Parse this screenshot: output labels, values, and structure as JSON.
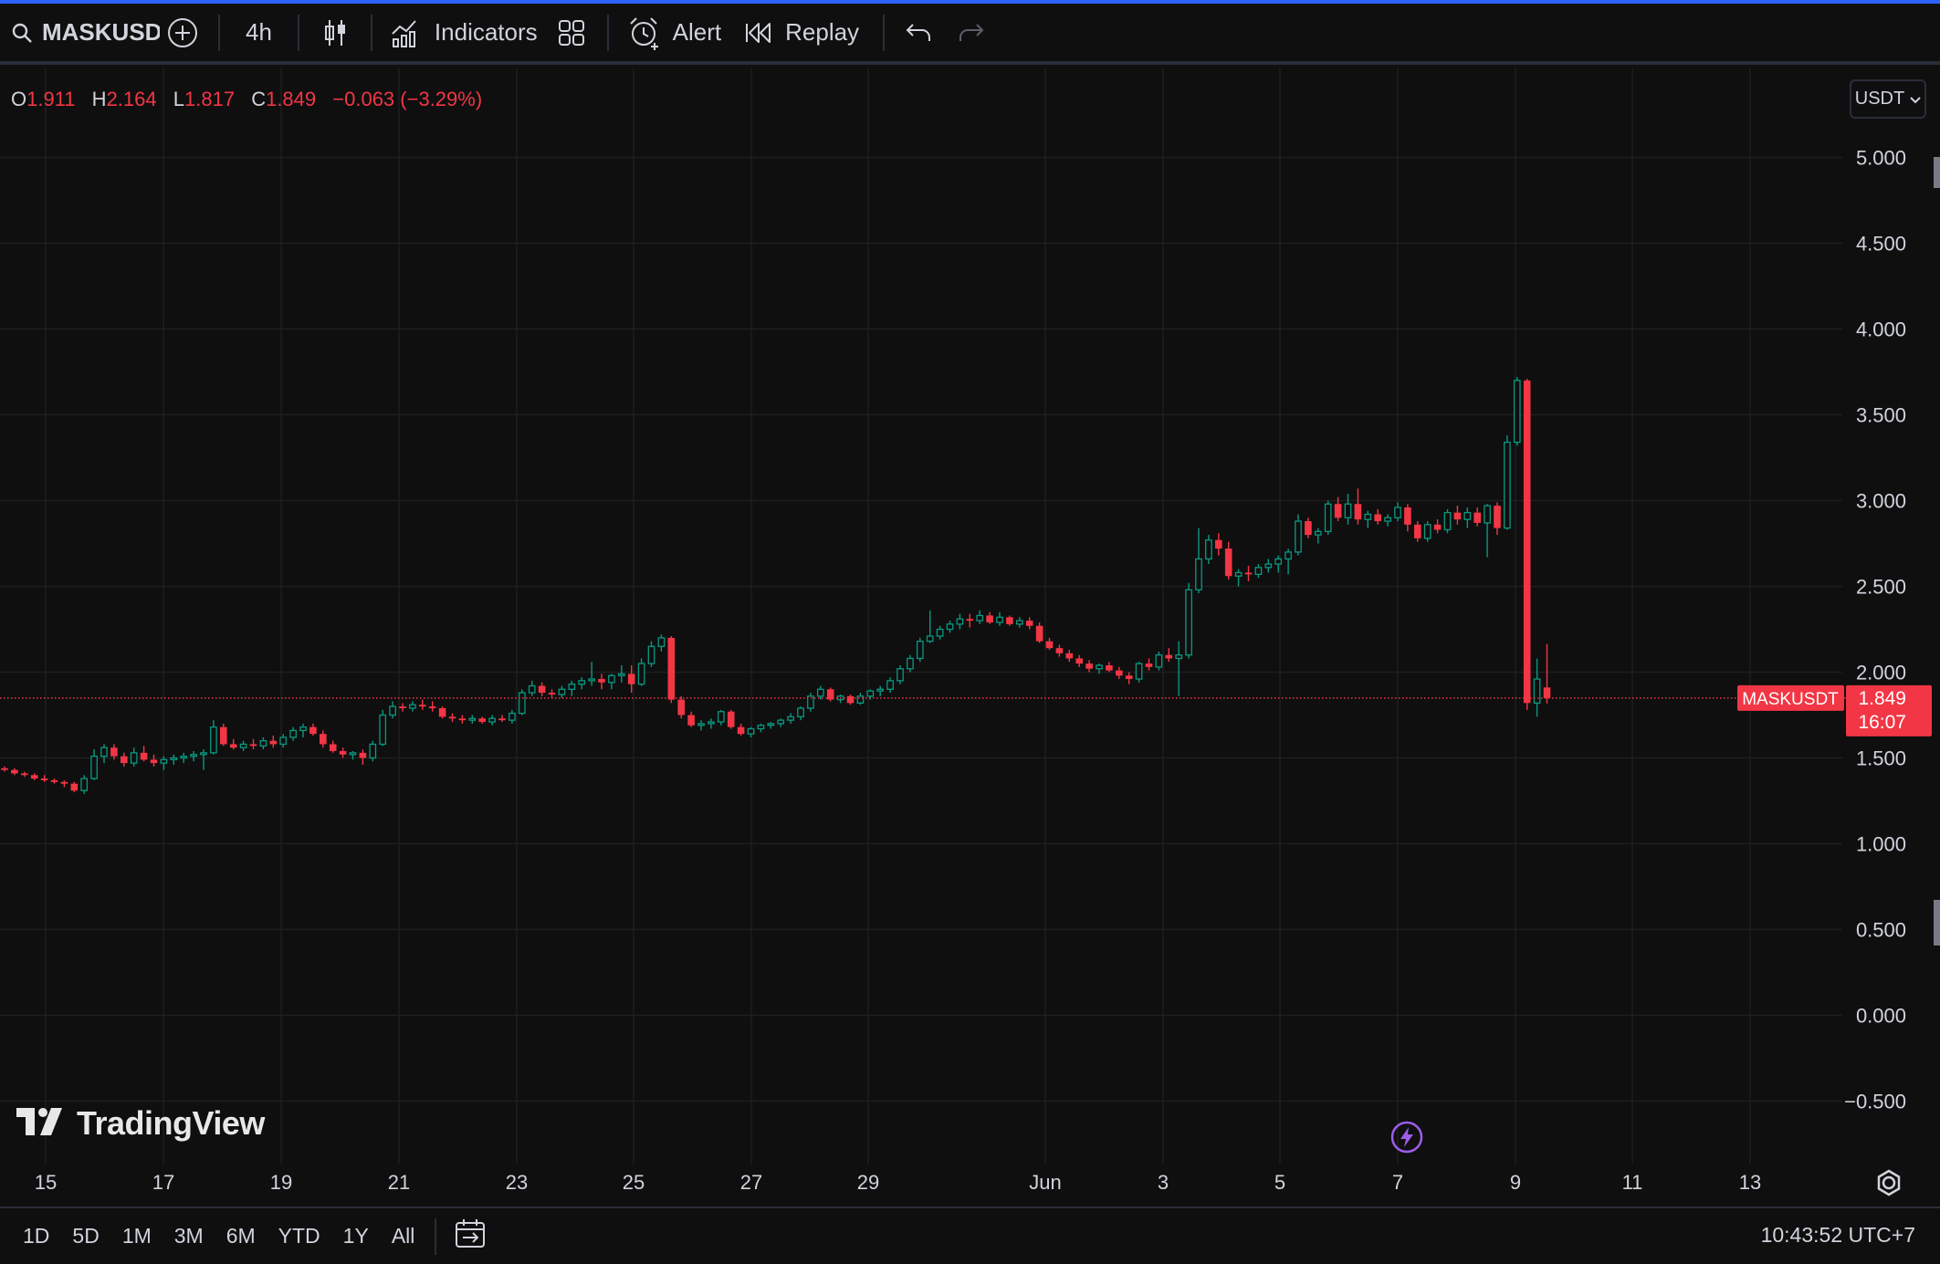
{
  "toolbar": {
    "symbol": "MASKUSDT",
    "interval": "4h",
    "indicators_label": "Indicators",
    "alert_label": "Alert",
    "replay_label": "Replay"
  },
  "legend": {
    "open_key": "O",
    "open_val": "1.911",
    "high_key": "H",
    "high_val": "2.164",
    "low_key": "L",
    "low_val": "1.817",
    "close_key": "C",
    "close_val": "1.849",
    "change": "−0.063 (−3.29%)"
  },
  "currency": "USDT",
  "price_label": {
    "symbol": "MASKUSDT",
    "price": "1.849",
    "countdown": "16:07"
  },
  "logo_text": "TradingView",
  "bottombar": {
    "ranges": [
      "1D",
      "5D",
      "1M",
      "3M",
      "6M",
      "YTD",
      "1Y",
      "All"
    ],
    "clock": "10:43:52 UTC+7"
  },
  "colors": {
    "background": "#0f0f0f",
    "up": "#089981",
    "down": "#f23645",
    "grid": "#1f1f1f",
    "text": "#d1d4dc"
  },
  "chart_data": {
    "type": "candlestick",
    "symbol": "MASKUSDT",
    "interval": "4h",
    "y_ticks": [
      "5.000",
      "4.500",
      "4.000",
      "3.500",
      "3.000",
      "2.500",
      "2.000",
      "1.500",
      "1.000",
      "0.500",
      "0.000",
      "−0.500"
    ],
    "ylim": [
      -0.6,
      5.4
    ],
    "x_ticks": [
      "15",
      "17",
      "19",
      "21",
      "23",
      "25",
      "27",
      "29",
      "Jun",
      "3",
      "5",
      "7",
      "9",
      "11",
      "13"
    ],
    "last_price": 1.849,
    "grid": true,
    "candles": [
      [
        1.44,
        1.45,
        1.42,
        1.43
      ],
      [
        1.43,
        1.44,
        1.4,
        1.41
      ],
      [
        1.41,
        1.42,
        1.39,
        1.4
      ],
      [
        1.4,
        1.41,
        1.37,
        1.38
      ],
      [
        1.38,
        1.4,
        1.36,
        1.37
      ],
      [
        1.37,
        1.38,
        1.35,
        1.36
      ],
      [
        1.36,
        1.37,
        1.33,
        1.35
      ],
      [
        1.35,
        1.36,
        1.3,
        1.31
      ],
      [
        1.31,
        1.4,
        1.29,
        1.38
      ],
      [
        1.38,
        1.55,
        1.37,
        1.51
      ],
      [
        1.51,
        1.58,
        1.47,
        1.56
      ],
      [
        1.56,
        1.58,
        1.49,
        1.51
      ],
      [
        1.51,
        1.53,
        1.45,
        1.47
      ],
      [
        1.47,
        1.56,
        1.45,
        1.53
      ],
      [
        1.53,
        1.57,
        1.48,
        1.49
      ],
      [
        1.49,
        1.52,
        1.45,
        1.47
      ],
      [
        1.47,
        1.51,
        1.43,
        1.49
      ],
      [
        1.49,
        1.52,
        1.46,
        1.5
      ],
      [
        1.5,
        1.53,
        1.47,
        1.51
      ],
      [
        1.51,
        1.54,
        1.48,
        1.52
      ],
      [
        1.52,
        1.55,
        1.43,
        1.53
      ],
      [
        1.53,
        1.72,
        1.52,
        1.68
      ],
      [
        1.68,
        1.7,
        1.57,
        1.58
      ],
      [
        1.58,
        1.61,
        1.55,
        1.56
      ],
      [
        1.56,
        1.6,
        1.54,
        1.58
      ],
      [
        1.58,
        1.61,
        1.55,
        1.57
      ],
      [
        1.57,
        1.62,
        1.55,
        1.6
      ],
      [
        1.6,
        1.63,
        1.56,
        1.58
      ],
      [
        1.58,
        1.64,
        1.56,
        1.62
      ],
      [
        1.62,
        1.68,
        1.6,
        1.66
      ],
      [
        1.66,
        1.7,
        1.62,
        1.68
      ],
      [
        1.68,
        1.7,
        1.63,
        1.64
      ],
      [
        1.64,
        1.66,
        1.56,
        1.58
      ],
      [
        1.58,
        1.6,
        1.53,
        1.54
      ],
      [
        1.54,
        1.56,
        1.5,
        1.52
      ],
      [
        1.52,
        1.54,
        1.49,
        1.53
      ],
      [
        1.53,
        1.55,
        1.46,
        1.5
      ],
      [
        1.5,
        1.6,
        1.48,
        1.58
      ],
      [
        1.58,
        1.78,
        1.57,
        1.75
      ],
      [
        1.75,
        1.83,
        1.73,
        1.8
      ],
      [
        1.8,
        1.82,
        1.77,
        1.79
      ],
      [
        1.79,
        1.83,
        1.77,
        1.81
      ],
      [
        1.81,
        1.84,
        1.78,
        1.8
      ],
      [
        1.8,
        1.83,
        1.77,
        1.79
      ],
      [
        1.79,
        1.8,
        1.73,
        1.74
      ],
      [
        1.74,
        1.76,
        1.71,
        1.73
      ],
      [
        1.73,
        1.75,
        1.7,
        1.72
      ],
      [
        1.72,
        1.75,
        1.7,
        1.73
      ],
      [
        1.73,
        1.74,
        1.7,
        1.71
      ],
      [
        1.71,
        1.75,
        1.69,
        1.73
      ],
      [
        1.73,
        1.75,
        1.71,
        1.72
      ],
      [
        1.72,
        1.78,
        1.7,
        1.76
      ],
      [
        1.76,
        1.9,
        1.75,
        1.88
      ],
      [
        1.88,
        1.95,
        1.86,
        1.92
      ],
      [
        1.92,
        1.94,
        1.86,
        1.88
      ],
      [
        1.88,
        1.9,
        1.85,
        1.87
      ],
      [
        1.87,
        1.92,
        1.85,
        1.9
      ],
      [
        1.9,
        1.95,
        1.86,
        1.93
      ],
      [
        1.93,
        1.97,
        1.9,
        1.95
      ],
      [
        1.95,
        2.06,
        1.92,
        1.96
      ],
      [
        1.96,
        1.99,
        1.9,
        1.94
      ],
      [
        1.94,
        1.99,
        1.9,
        1.98
      ],
      [
        1.98,
        2.04,
        1.94,
        1.99
      ],
      [
        1.99,
        2.04,
        1.88,
        1.93
      ],
      [
        1.93,
        2.08,
        1.92,
        2.05
      ],
      [
        2.05,
        2.18,
        2.03,
        2.15
      ],
      [
        2.15,
        2.22,
        2.12,
        2.2
      ],
      [
        2.2,
        2.21,
        1.82,
        1.84
      ],
      [
        1.84,
        1.86,
        1.73,
        1.75
      ],
      [
        1.75,
        1.77,
        1.68,
        1.69
      ],
      [
        1.69,
        1.72,
        1.66,
        1.7
      ],
      [
        1.7,
        1.73,
        1.67,
        1.71
      ],
      [
        1.71,
        1.78,
        1.69,
        1.77
      ],
      [
        1.77,
        1.78,
        1.67,
        1.68
      ],
      [
        1.68,
        1.7,
        1.63,
        1.64
      ],
      [
        1.64,
        1.68,
        1.62,
        1.67
      ],
      [
        1.67,
        1.7,
        1.65,
        1.69
      ],
      [
        1.69,
        1.71,
        1.67,
        1.7
      ],
      [
        1.7,
        1.73,
        1.68,
        1.72
      ],
      [
        1.72,
        1.76,
        1.7,
        1.74
      ],
      [
        1.74,
        1.8,
        1.72,
        1.79
      ],
      [
        1.79,
        1.88,
        1.77,
        1.86
      ],
      [
        1.86,
        1.92,
        1.84,
        1.9
      ],
      [
        1.9,
        1.91,
        1.83,
        1.84
      ],
      [
        1.84,
        1.87,
        1.82,
        1.86
      ],
      [
        1.86,
        1.87,
        1.81,
        1.82
      ],
      [
        1.82,
        1.88,
        1.81,
        1.86
      ],
      [
        1.86,
        1.9,
        1.84,
        1.89
      ],
      [
        1.89,
        1.92,
        1.86,
        1.9
      ],
      [
        1.9,
        1.97,
        1.88,
        1.95
      ],
      [
        1.95,
        2.04,
        1.93,
        2.02
      ],
      [
        2.02,
        2.1,
        2.0,
        2.08
      ],
      [
        2.08,
        2.2,
        2.06,
        2.18
      ],
      [
        2.18,
        2.36,
        2.17,
        2.21
      ],
      [
        2.21,
        2.27,
        2.19,
        2.25
      ],
      [
        2.25,
        2.3,
        2.23,
        2.28
      ],
      [
        2.28,
        2.34,
        2.25,
        2.31
      ],
      [
        2.31,
        2.34,
        2.26,
        2.3
      ],
      [
        2.3,
        2.36,
        2.28,
        2.33
      ],
      [
        2.33,
        2.35,
        2.28,
        2.29
      ],
      [
        2.29,
        2.35,
        2.27,
        2.32
      ],
      [
        2.32,
        2.33,
        2.27,
        2.28
      ],
      [
        2.28,
        2.32,
        2.26,
        2.3
      ],
      [
        2.3,
        2.32,
        2.25,
        2.27
      ],
      [
        2.27,
        2.29,
        2.17,
        2.18
      ],
      [
        2.18,
        2.2,
        2.13,
        2.14
      ],
      [
        2.14,
        2.16,
        2.09,
        2.11
      ],
      [
        2.11,
        2.13,
        2.06,
        2.08
      ],
      [
        2.08,
        2.1,
        2.03,
        2.05
      ],
      [
        2.05,
        2.07,
        2.0,
        2.02
      ],
      [
        2.02,
        2.05,
        1.99,
        2.04
      ],
      [
        2.04,
        2.06,
        2.0,
        2.01
      ],
      [
        2.01,
        2.03,
        1.96,
        1.98
      ],
      [
        1.98,
        2.0,
        1.93,
        1.96
      ],
      [
        1.96,
        2.06,
        1.94,
        2.05
      ],
      [
        2.05,
        2.08,
        2.01,
        2.03
      ],
      [
        2.03,
        2.12,
        2.01,
        2.1
      ],
      [
        2.1,
        2.14,
        2.06,
        2.08
      ],
      [
        2.08,
        2.18,
        1.86,
        2.1
      ],
      [
        2.1,
        2.52,
        2.08,
        2.48
      ],
      [
        2.48,
        2.84,
        2.46,
        2.66
      ],
      [
        2.66,
        2.8,
        2.63,
        2.77
      ],
      [
        2.77,
        2.81,
        2.68,
        2.72
      ],
      [
        2.72,
        2.76,
        2.54,
        2.56
      ],
      [
        2.56,
        2.6,
        2.5,
        2.58
      ],
      [
        2.58,
        2.62,
        2.53,
        2.57
      ],
      [
        2.57,
        2.63,
        2.55,
        2.61
      ],
      [
        2.61,
        2.66,
        2.58,
        2.63
      ],
      [
        2.63,
        2.68,
        2.58,
        2.66
      ],
      [
        2.66,
        2.72,
        2.57,
        2.7
      ],
      [
        2.7,
        2.92,
        2.68,
        2.88
      ],
      [
        2.88,
        2.9,
        2.78,
        2.8
      ],
      [
        2.8,
        2.84,
        2.75,
        2.82
      ],
      [
        2.82,
        3.0,
        2.8,
        2.98
      ],
      [
        2.98,
        3.02,
        2.88,
        2.9
      ],
      [
        2.9,
        3.04,
        2.86,
        2.98
      ],
      [
        2.98,
        3.07,
        2.86,
        2.89
      ],
      [
        2.89,
        2.94,
        2.84,
        2.92
      ],
      [
        2.92,
        2.95,
        2.86,
        2.88
      ],
      [
        2.88,
        2.92,
        2.85,
        2.9
      ],
      [
        2.9,
        2.99,
        2.88,
        2.96
      ],
      [
        2.96,
        2.98,
        2.82,
        2.86
      ],
      [
        2.86,
        2.88,
        2.76,
        2.78
      ],
      [
        2.78,
        2.88,
        2.76,
        2.86
      ],
      [
        2.86,
        2.89,
        2.81,
        2.83
      ],
      [
        2.83,
        2.95,
        2.81,
        2.93
      ],
      [
        2.93,
        2.97,
        2.86,
        2.89
      ],
      [
        2.89,
        2.96,
        2.84,
        2.93
      ],
      [
        2.93,
        2.96,
        2.85,
        2.87
      ],
      [
        2.87,
        2.98,
        2.67,
        2.97
      ],
      [
        2.97,
        2.99,
        2.8,
        2.84
      ],
      [
        2.84,
        3.38,
        2.83,
        3.34
      ],
      [
        3.34,
        3.72,
        3.32,
        3.7
      ],
      [
        3.7,
        3.71,
        1.78,
        1.82
      ],
      [
        1.82,
        2.08,
        1.74,
        1.96
      ],
      [
        1.911,
        2.164,
        1.817,
        1.849
      ]
    ]
  }
}
